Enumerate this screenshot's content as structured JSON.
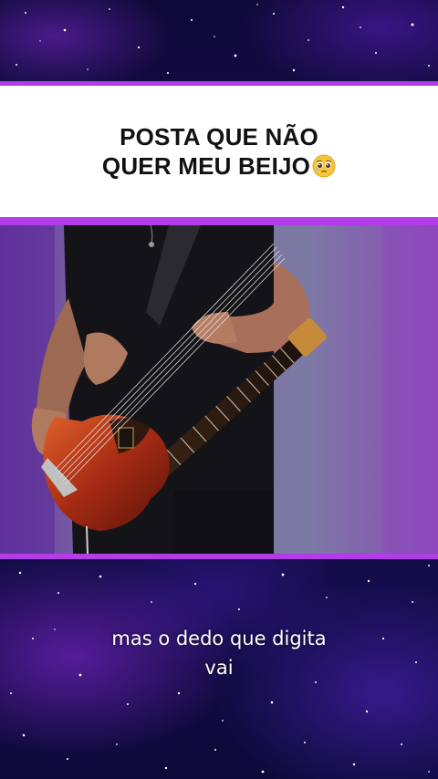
{
  "title": {
    "line1": "POSTA QUE NÃO",
    "line2": "QUER MEU BEIJO",
    "emoji": "pleading-face-icon"
  },
  "video": {
    "subject": "bass-guitar-player"
  },
  "subtitle": {
    "line1": "mas o dedo que digita",
    "line2": "vai"
  },
  "colors": {
    "accent": "#b23ce6",
    "title_bg": "#ffffff",
    "title_text": "#111111",
    "subtitle_text": "#ffffff"
  }
}
